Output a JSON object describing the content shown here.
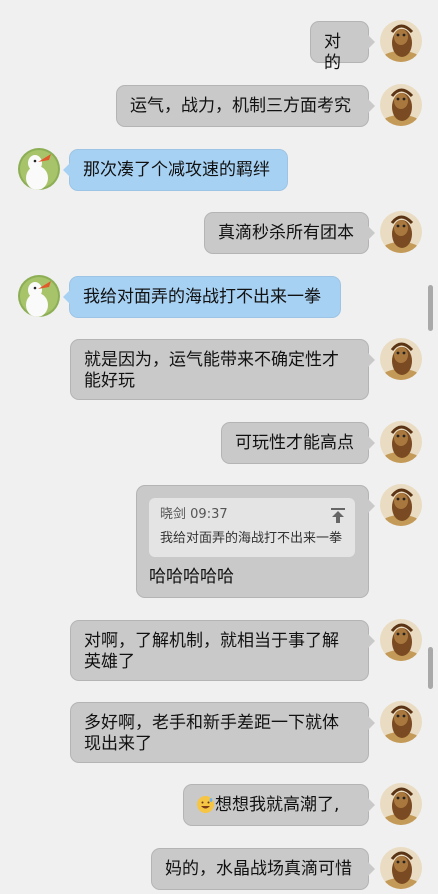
{
  "messages": [
    {
      "side": "me",
      "text": "对的"
    },
    {
      "side": "me",
      "text": "运气，战力，机制三方面考究"
    },
    {
      "side": "other",
      "text": "那次凑了个减攻速的羁绊"
    },
    {
      "side": "me",
      "text": "真滴秒杀所有团本"
    },
    {
      "side": "other",
      "text": "我给对面弄的海战打不出来一拳"
    },
    {
      "side": "me",
      "text": "就是因为，运气能带来不确定性才能好玩"
    },
    {
      "side": "me",
      "text": "可玩性才能高点"
    },
    {
      "side": "me",
      "quote": {
        "sender": "晓剑",
        "time": "09:37",
        "text": "我给对面弄的海战打不出来一拳"
      },
      "text": "哈哈哈哈哈"
    },
    {
      "side": "me",
      "text": "对啊，了解机制，就相当于事了解英雄了"
    },
    {
      "side": "me",
      "text": "多好啊，老手和新手差距一下就体现出来了"
    },
    {
      "side": "me",
      "emoji": "grinning-sweat-emoji",
      "text": "想想我就高潮了,"
    },
    {
      "side": "me",
      "text": "妈的，水晶战场真滴可惜"
    }
  ],
  "colors": {
    "my_bubble": "#c9c9c9",
    "their_bubble": "#a7d1f3",
    "background": "#f0f0f0"
  }
}
